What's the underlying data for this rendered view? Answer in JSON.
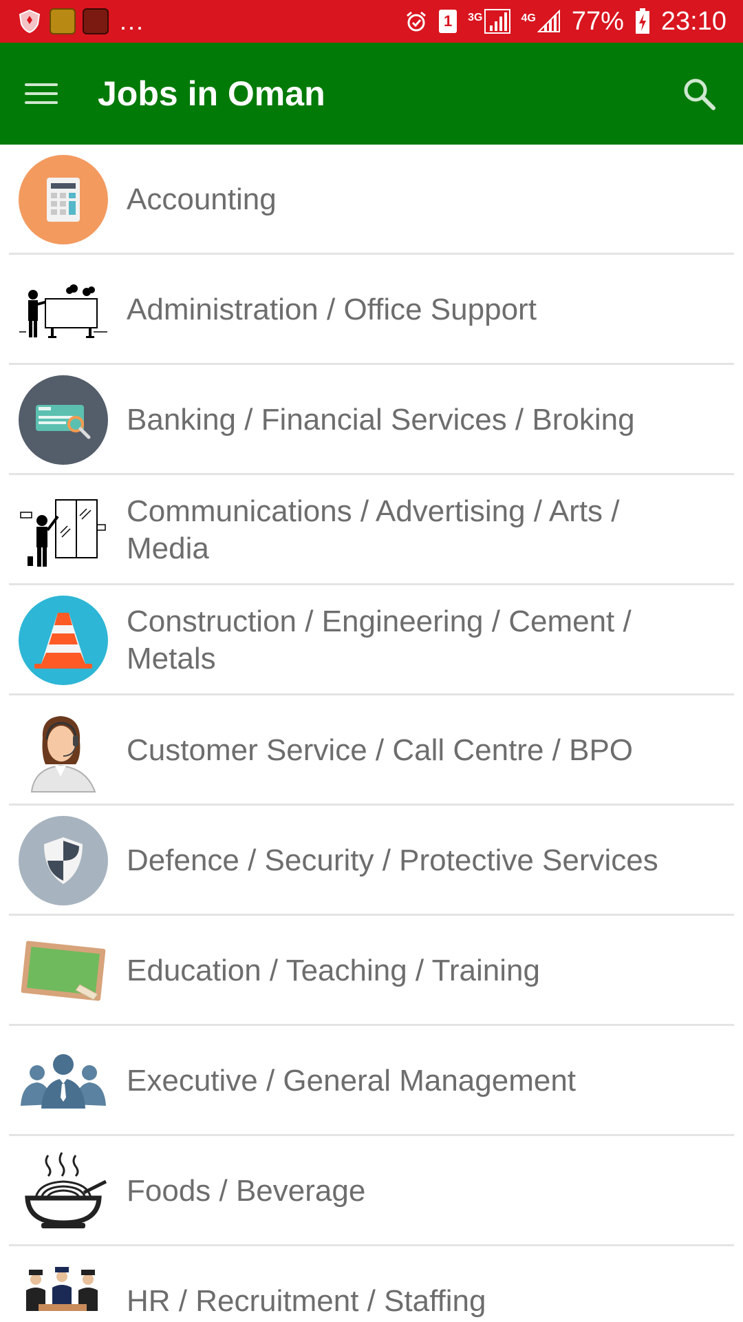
{
  "status_bar": {
    "more": "...",
    "network_3g": "3G",
    "network_4g": "4G",
    "sim_slot": "1",
    "battery": "77%",
    "time": "23:10"
  },
  "app_bar": {
    "title": "Jobs in Oman",
    "menu_icon": "hamburger-menu-icon",
    "search_icon": "search-icon"
  },
  "categories": [
    {
      "label": "Accounting",
      "icon": "calculator-icon"
    },
    {
      "label": "Administration / Office Support",
      "icon": "presenter-board-icon"
    },
    {
      "label": "Banking / Financial Services / Broking",
      "icon": "cheque-icon"
    },
    {
      "label": "Communications / Advertising / Arts / Media",
      "icon": "painter-icon"
    },
    {
      "label": "Construction / Engineering / Cement / Metals",
      "icon": "traffic-cone-icon"
    },
    {
      "label": "Customer Service / Call Centre / BPO",
      "icon": "call-center-agent-icon"
    },
    {
      "label": "Defence / Security / Protective Services",
      "icon": "shield-icon"
    },
    {
      "label": "Education / Teaching / Training",
      "icon": "chalkboard-icon"
    },
    {
      "label": "Executive / General Management",
      "icon": "executive-group-icon"
    },
    {
      "label": "Foods / Beverage",
      "icon": "noodle-bowl-icon"
    },
    {
      "label": "HR / Recruitment / Staffing",
      "icon": "staff-group-icon"
    }
  ],
  "colors": {
    "status_bar": "#d9151f",
    "app_bar": "#027a07",
    "label_text": "#6d6d6d",
    "divider": "#e4e4e4"
  }
}
